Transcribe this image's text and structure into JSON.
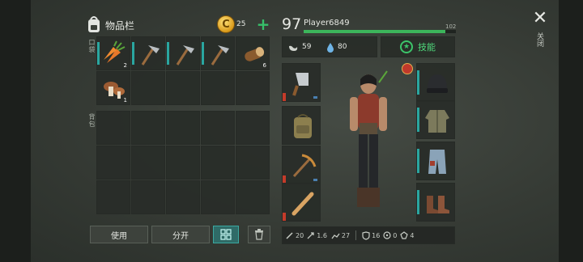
{
  "inventory": {
    "title": "物品栏",
    "coins": "25",
    "section_backpack": "背包",
    "section_pockets": "口袋",
    "slots": [
      {
        "item": "carrot",
        "qty": "2"
      },
      {
        "item": "hatchet",
        "qty": ""
      },
      {
        "item": "hatchet",
        "qty": ""
      },
      {
        "item": "hatchet",
        "qty": ""
      },
      {
        "item": "log",
        "qty": "6"
      },
      {
        "item": "mushroom",
        "qty": "1"
      }
    ]
  },
  "buttons": {
    "use": "使用",
    "split": "分开"
  },
  "character": {
    "level": "97",
    "name": "Player6849",
    "xp_max": "102",
    "xp_progress": 0.93,
    "hunger": "59",
    "thirst": "80",
    "skills_label": "技能"
  },
  "stats": {
    "attack": "20",
    "attack_speed": "1.6",
    "speed": "27",
    "defense": "16",
    "toxic": "0",
    "resist": "4"
  },
  "side": {
    "close_label": "关闭"
  },
  "colors": {
    "accent_green": "#3cb55b",
    "teal": "#2aa6a0",
    "red_durability": "#c43b2a"
  }
}
